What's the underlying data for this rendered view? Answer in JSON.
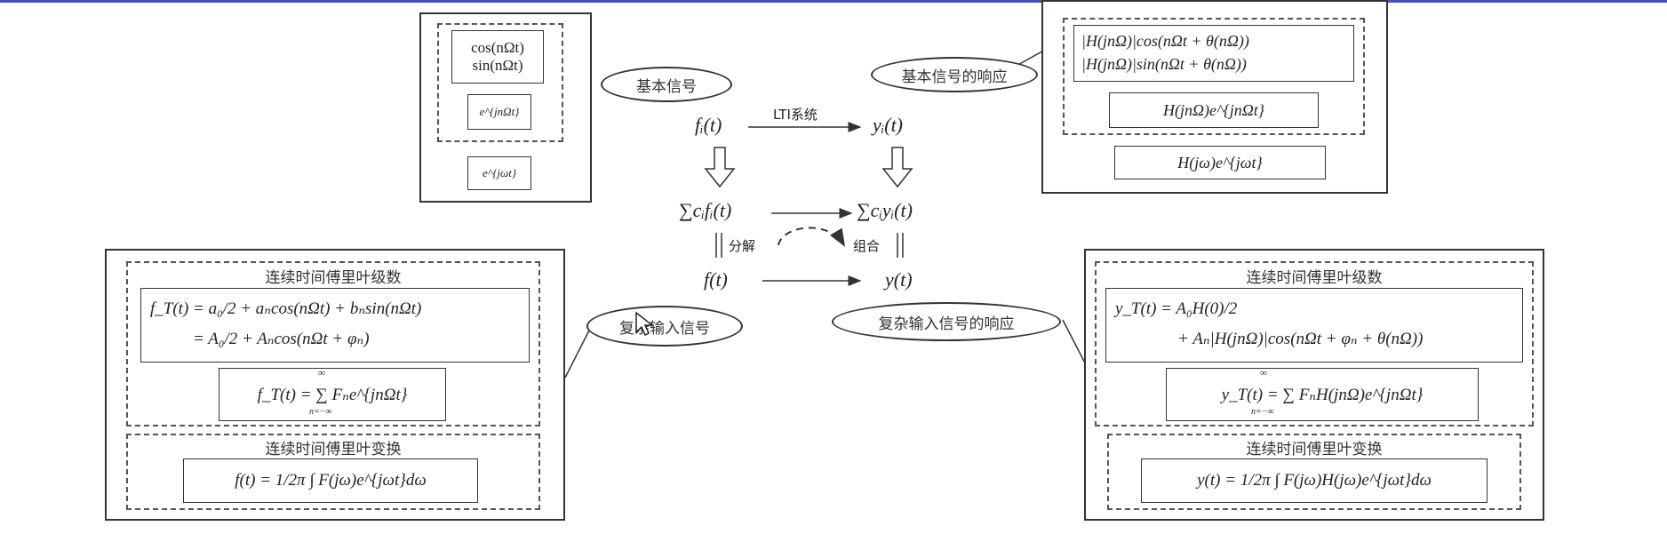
{
  "top_left": {
    "basic_cos": "cos(nΩt)",
    "basic_sin": "sin(nΩt)",
    "basic_exp_n": "e^{jnΩt}",
    "basic_exp_w": "e^{jωt}"
  },
  "top_right": {
    "resp_cos": "|H(jnΩ)|cos(nΩt + θ(nΩ))",
    "resp_sin": "|H(jnΩ)|sin(nΩt + θ(nΩ))",
    "resp_exp_n": "H(jnΩ)e^{jnΩt}",
    "resp_exp_w": "H(jω)e^{jωt}"
  },
  "center": {
    "fi": "fᵢ(t)",
    "yi": "yᵢ(t)",
    "lti": "LTI系统",
    "sum_f": "∑cᵢfᵢ(t)",
    "sum_y": "∑cᵢyᵢ(t)",
    "decompose": "分解",
    "combine": "组合",
    "f": "f(t)",
    "y": "y(t)"
  },
  "ellipses": {
    "basic_signal": "基本信号",
    "basic_response": "基本信号的响应",
    "complex_input": "复杂输入信号",
    "complex_response": "复杂输入信号的响应"
  },
  "bottom_left": {
    "series_title": "连续时间傅里叶级数",
    "series_line1": "f_T(t) = a₀/2 + aₙcos(nΩt) + bₙsin(nΩt)",
    "series_line2": "= A₀/2 + Aₙcos(nΩt + φₙ)",
    "series_exp": "f_T(t) = ∑ Fₙe^{jnΩt}",
    "sum_top": "∞",
    "sum_bottom": "n=−∞",
    "transform_title": "连续时间傅里叶变换",
    "transform_formula": "f(t) = 1/2π ∫ F(jω)e^{jωt}dω"
  },
  "bottom_right": {
    "series_title": "连续时间傅里叶级数",
    "series_line1": "y_T(t) = A₀H(0)/2",
    "series_line2": "+ Aₙ|H(jnΩ)|cos(nΩt + φₙ + θ(nΩ))",
    "series_exp": "y_T(t) = ∑ FₙH(jnΩ)e^{jnΩt}",
    "sum_top": "∞",
    "sum_bottom": "n=−∞",
    "transform_title": "连续时间傅里叶变换",
    "transform_formula": "y(t) = 1/2π ∫ F(jω)H(jω)e^{jωt}dω"
  }
}
